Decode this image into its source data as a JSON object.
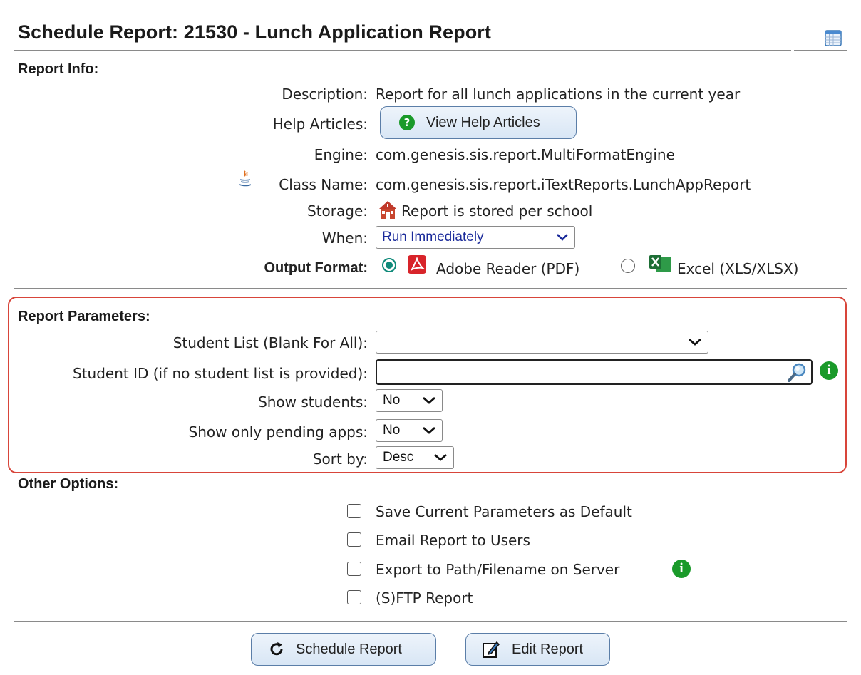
{
  "header": {
    "title": "Schedule Report: 21530 - Lunch Application Report",
    "calendar_icon": "calendar-icon"
  },
  "report_info": {
    "heading": "Report Info:",
    "description_label": "Description:",
    "description_value": "Report for all lunch applications in the current year",
    "help_label": "Help Articles:",
    "help_button": "View Help Articles",
    "engine_label": "Engine:",
    "engine_value": "com.genesis.sis.report.MultiFormatEngine",
    "class_label": "Class Name:",
    "class_value": "com.genesis.sis.report.iTextReports.LunchAppReport",
    "storage_label": "Storage:",
    "storage_value": "Report is stored per school",
    "when_label": "When:",
    "when_value": "Run Immediately",
    "output_label": "Output Format:",
    "output_pdf": "Adobe Reader (PDF)",
    "output_xls": "Excel (XLS/XLSX)",
    "output_selected": "pdf"
  },
  "parameters": {
    "heading": "Report Parameters:",
    "student_list_label": "Student List (Blank For All):",
    "student_list_value": "",
    "student_id_label": "Student ID (if no student list is provided):",
    "student_id_value": "",
    "show_students_label": "Show students:",
    "show_students_value": "No",
    "pending_label": "Show only pending apps:",
    "pending_value": "No",
    "sort_label": "Sort by:",
    "sort_value": "Desc"
  },
  "other_options": {
    "heading": "Other Options:",
    "items": [
      {
        "label": "Save Current Parameters as Default",
        "checked": false
      },
      {
        "label": "Email Report to Users",
        "checked": false
      },
      {
        "label": "Export to Path/Filename on Server",
        "checked": false
      },
      {
        "label": "(S)FTP Report",
        "checked": false
      }
    ]
  },
  "actions": {
    "schedule_button": "Schedule Report",
    "edit_button": "Edit Report"
  },
  "colors": {
    "highlight_border": "#d8453a",
    "radio_accent": "#0f8a7a",
    "info_green": "#1a9a2a",
    "select_text_blue": "#1a2a9a"
  }
}
